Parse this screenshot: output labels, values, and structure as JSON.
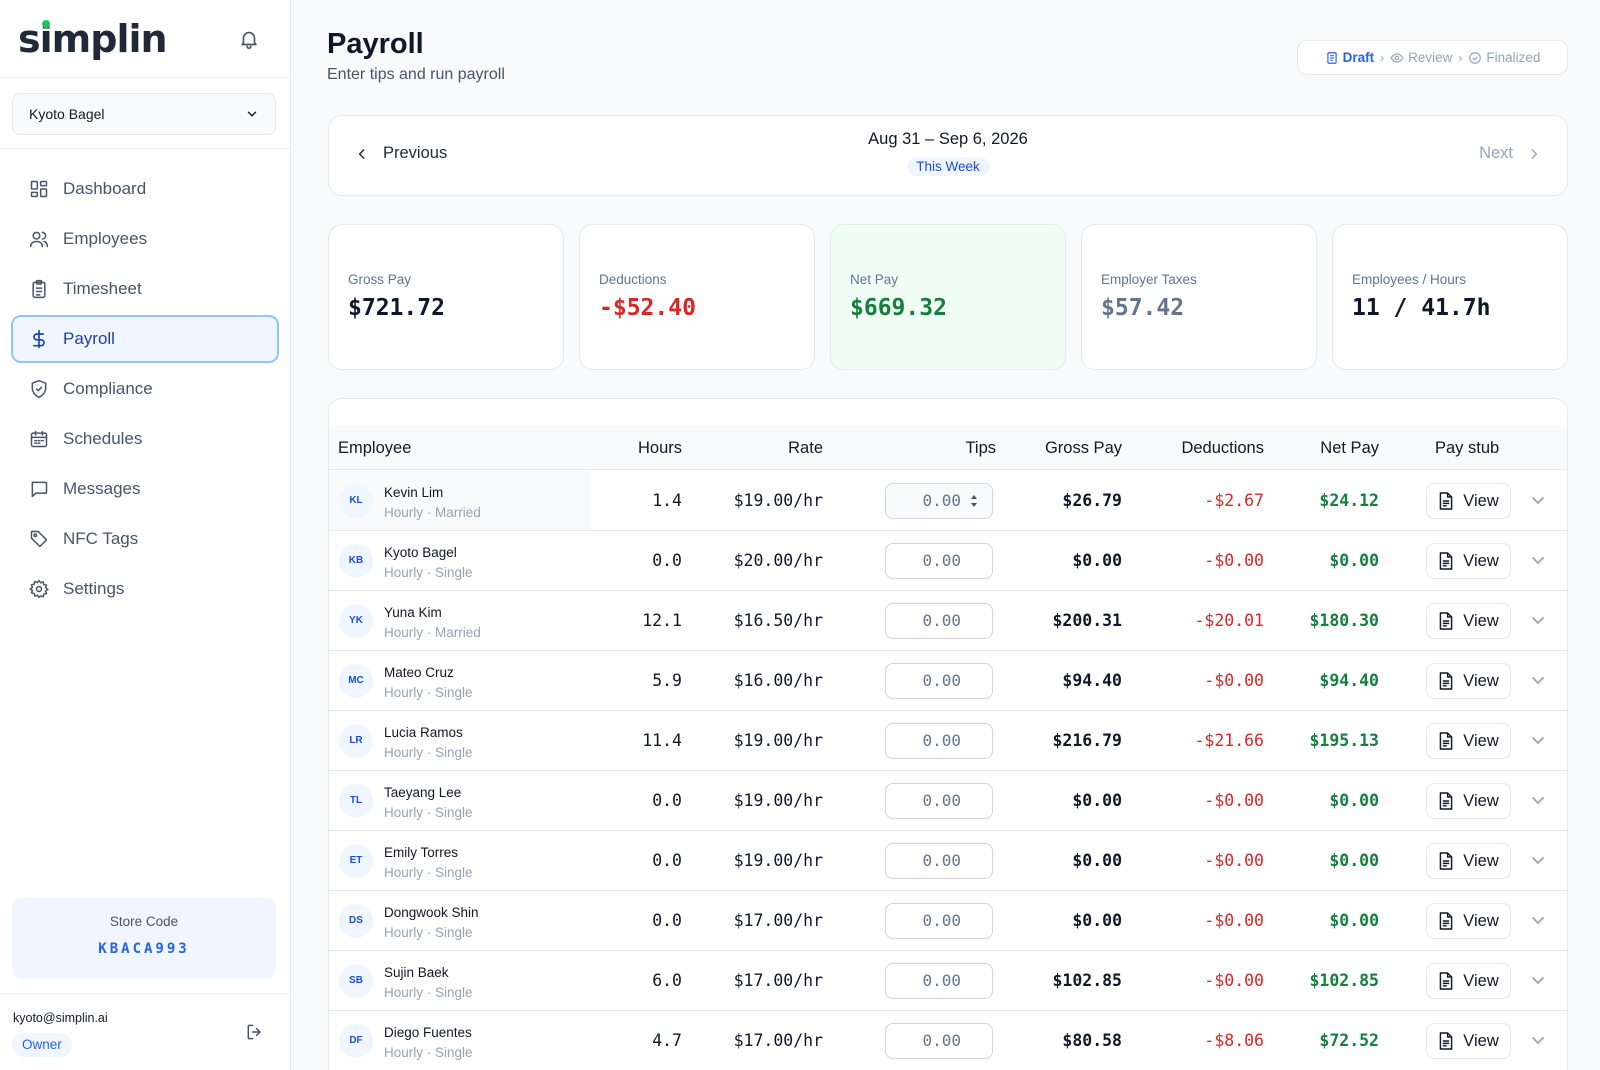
{
  "app": {
    "brand": "simplin"
  },
  "store_selector": {
    "value": "Kyoto Bagel"
  },
  "nav": [
    {
      "label": "Dashboard",
      "icon": "dashboard-icon"
    },
    {
      "label": "Employees",
      "icon": "users-icon"
    },
    {
      "label": "Timesheet",
      "icon": "clipboard-icon"
    },
    {
      "label": "Payroll",
      "icon": "dollar-icon",
      "active": true
    },
    {
      "label": "Compliance",
      "icon": "shield-check-icon"
    },
    {
      "label": "Schedules",
      "icon": "calendar-icon"
    },
    {
      "label": "Messages",
      "icon": "message-icon"
    },
    {
      "label": "NFC Tags",
      "icon": "tag-icon"
    },
    {
      "label": "Settings",
      "icon": "gear-icon"
    }
  ],
  "store_code": {
    "label": "Store Code",
    "value": "KBACA993"
  },
  "user": {
    "email": "kyoto@simplin.ai",
    "role": "Owner"
  },
  "page": {
    "title": "Payroll",
    "subtitle": "Enter tips and run payroll"
  },
  "status_steps": [
    {
      "label": "Draft",
      "current": true
    },
    {
      "label": "Review",
      "current": false
    },
    {
      "label": "Finalized",
      "current": false
    }
  ],
  "period": {
    "prev": "Previous",
    "next": "Next",
    "range": "Aug 31 – Sep 6, 2026",
    "badge": "This Week"
  },
  "summary": [
    {
      "label": "Gross Pay",
      "value": "$721.72",
      "color": "#0f172a"
    },
    {
      "label": "Deductions",
      "value": "-$52.40",
      "color": "#dc2626"
    },
    {
      "label": "Net Pay",
      "value": "$669.32",
      "color": "#15803d"
    },
    {
      "label": "Employer Taxes",
      "value": "$57.42",
      "color": "#64748b"
    },
    {
      "label": "Employees / Hours",
      "value": "11 / 41.7h",
      "color": "#0f172a"
    }
  ],
  "table": {
    "headers": [
      "Employee",
      "Hours",
      "Rate",
      "Tips",
      "Gross Pay",
      "Deductions",
      "Net Pay",
      "Pay stub"
    ],
    "view_label": "View",
    "rows": [
      {
        "initials": "KL",
        "name": "Kevin Lim",
        "meta": "Hourly · Married",
        "hours": "1.4",
        "rate": "$19.00/hr",
        "tips": "0.00",
        "gross": "$26.79",
        "deductions": "-$2.67",
        "net": "$24.12"
      },
      {
        "initials": "KB",
        "name": "Kyoto Bagel",
        "meta": "Hourly · Single",
        "hours": "0.0",
        "rate": "$20.00/hr",
        "tips": "0.00",
        "gross": "$0.00",
        "deductions": "-$0.00",
        "net": "$0.00"
      },
      {
        "initials": "YK",
        "name": "Yuna Kim",
        "meta": "Hourly · Married",
        "hours": "12.1",
        "rate": "$16.50/hr",
        "tips": "0.00",
        "gross": "$200.31",
        "deductions": "-$20.01",
        "net": "$180.30"
      },
      {
        "initials": "MC",
        "name": "Mateo Cruz",
        "meta": "Hourly · Single",
        "hours": "5.9",
        "rate": "$16.00/hr",
        "tips": "0.00",
        "gross": "$94.40",
        "deductions": "-$0.00",
        "net": "$94.40"
      },
      {
        "initials": "LR",
        "name": "Lucia Ramos",
        "meta": "Hourly · Single",
        "hours": "11.4",
        "rate": "$19.00/hr",
        "tips": "0.00",
        "gross": "$216.79",
        "deductions": "-$21.66",
        "net": "$195.13"
      },
      {
        "initials": "TL",
        "name": "Taeyang Lee",
        "meta": "Hourly · Single",
        "hours": "0.0",
        "rate": "$19.00/hr",
        "tips": "0.00",
        "gross": "$0.00",
        "deductions": "-$0.00",
        "net": "$0.00"
      },
      {
        "initials": "ET",
        "name": "Emily Torres",
        "meta": "Hourly · Single",
        "hours": "0.0",
        "rate": "$19.00/hr",
        "tips": "0.00",
        "gross": "$0.00",
        "deductions": "-$0.00",
        "net": "$0.00"
      },
      {
        "initials": "DS",
        "name": "Dongwook Shin",
        "meta": "Hourly · Single",
        "hours": "0.0",
        "rate": "$17.00/hr",
        "tips": "0.00",
        "gross": "$0.00",
        "deductions": "-$0.00",
        "net": "$0.00"
      },
      {
        "initials": "SB",
        "name": "Sujin Baek",
        "meta": "Hourly · Single",
        "hours": "6.0",
        "rate": "$17.00/hr",
        "tips": "0.00",
        "gross": "$102.85",
        "deductions": "-$0.00",
        "net": "$102.85"
      },
      {
        "initials": "DF",
        "name": "Diego Fuentes",
        "meta": "Hourly · Single",
        "hours": "4.7",
        "rate": "$17.00/hr",
        "tips": "0.00",
        "gross": "$80.58",
        "deductions": "-$8.06",
        "net": "$72.52"
      }
    ]
  }
}
